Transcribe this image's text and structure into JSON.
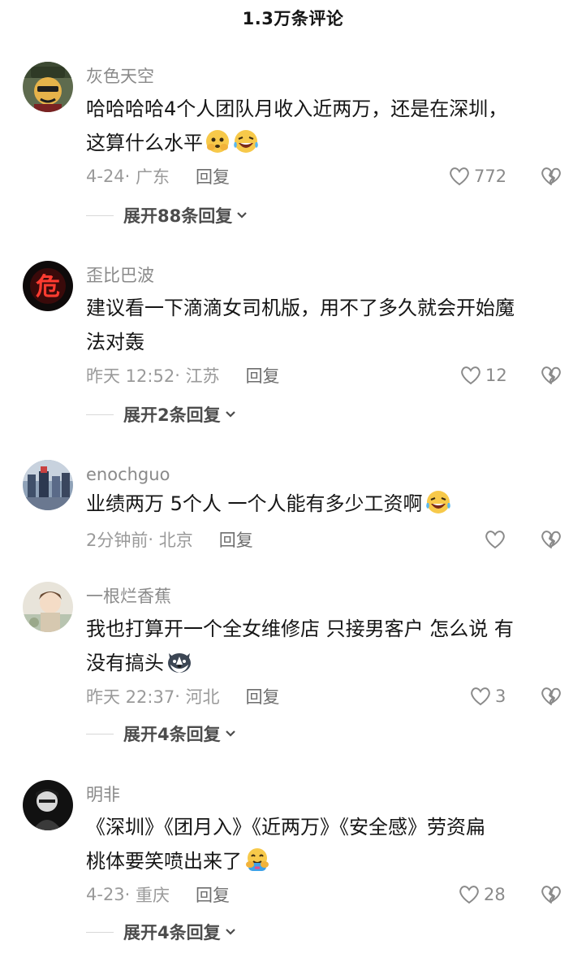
{
  "header": {
    "title": "1.3万条评论"
  },
  "comments": [
    {
      "username": "灰色天空",
      "lines": [
        "哈哈哈哈4个人团队月收入近两万，还是在深圳，",
        "这算什么水平"
      ],
      "emojis": [
        "peeking-face-emoji",
        "laughing-tears-emoji"
      ],
      "time": "4-24",
      "location": "广东",
      "reply_label": "回复",
      "likes": "772",
      "expand_label": "展开88条回复"
    },
    {
      "username": "歪比巴波",
      "lines": [
        "建议看一下滴滴女司机版，用不了多久就会开始魔",
        "法对轰"
      ],
      "emojis": [],
      "time": "昨天 12:52",
      "location": "江苏",
      "reply_label": "回复",
      "likes": "12",
      "expand_label": "展开2条回复"
    },
    {
      "username": "enochguo",
      "lines": [
        "业绩两万 5个人 一个人能有多少工资啊"
      ],
      "emojis": [
        "crying-laughing-emoji"
      ],
      "time": "2分钟前",
      "location": "北京",
      "reply_label": "回复",
      "likes": "",
      "expand_label": ""
    },
    {
      "username": "一根烂香蕉",
      "lines": [
        "我也打算开一个全女维修店 只接男客户 怎么说 有",
        "没有搞头"
      ],
      "emojis": [
        "husky-face-emoji"
      ],
      "time": "昨天 22:37",
      "location": "河北",
      "reply_label": "回复",
      "likes": "3",
      "expand_label": "展开4条回复"
    },
    {
      "username": "明非",
      "lines": [
        "《深圳》《团月入》《近两万》《安全感》劳资扁",
        "桃体要笑喷出来了"
      ],
      "emojis": [
        "hugging-face-emoji"
      ],
      "time": "4-23",
      "location": "重庆",
      "reply_label": "回复",
      "likes": "28",
      "expand_label": "展开4条回复"
    }
  ]
}
